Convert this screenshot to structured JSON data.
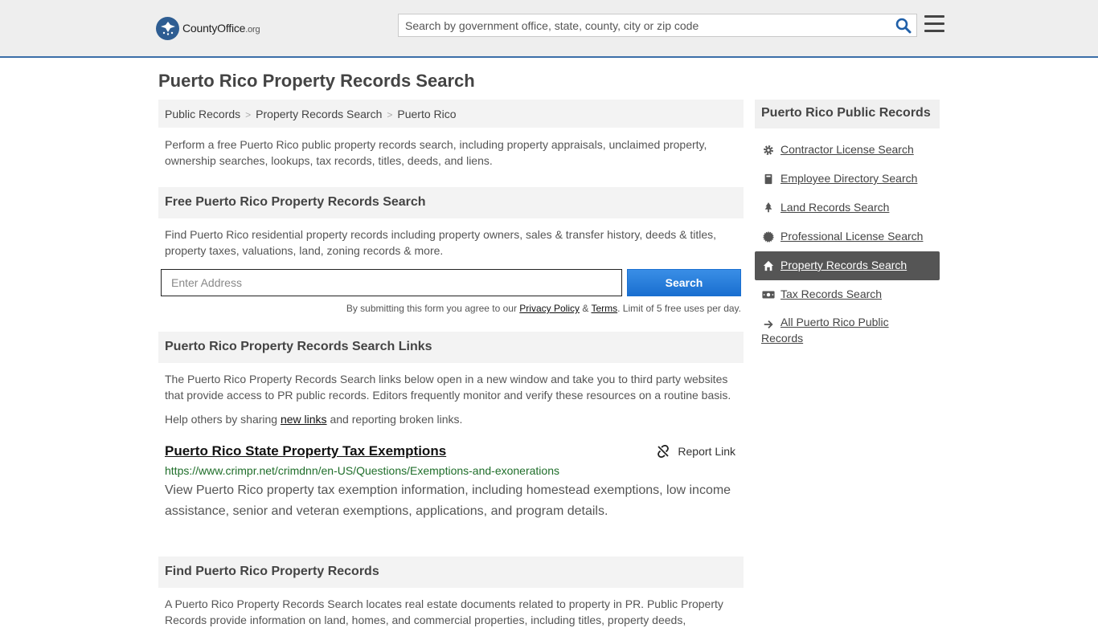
{
  "header": {
    "logo_main": "CountyOffice",
    "logo_suffix": ".org",
    "search_placeholder": "Search by government office, state, county, city or zip code"
  },
  "page_title": "Puerto Rico Property Records Search",
  "breadcrumb": [
    "Public Records",
    "Property Records Search",
    "Puerto Rico"
  ],
  "intro": "Perform a free Puerto Rico public property records search, including property appraisals, unclaimed property, ownership searches, lookups, tax records, titles, deeds, and liens.",
  "free_search": {
    "heading": "Free Puerto Rico Property Records Search",
    "description": "Find Puerto Rico residential property records including property owners, sales & transfer history, deeds & titles, property taxes, valuations, land, zoning records & more.",
    "address_placeholder": "Enter Address",
    "button_label": "Search",
    "terms_prefix": "By submitting this form you agree to our",
    "privacy_label": "Privacy Policy",
    "amp": "&",
    "terms_label": "Terms",
    "terms_suffix": ". Limit of 5 free uses per day."
  },
  "links_section": {
    "heading": "Puerto Rico Property Records Search Links",
    "description": "The Puerto Rico Property Records Search links below open in a new window and take you to third party websites that provide access to PR public records. Editors frequently monitor and verify these resources on a routine basis.",
    "share_prefix": "Help others by sharing",
    "share_link": "new links",
    "share_suffix": "and reporting broken links.",
    "entries": [
      {
        "title": "Puerto Rico State Property Tax Exemptions",
        "report_label": "Report Link",
        "url": "https://www.crimpr.net/crimdnn/en-US/Questions/Exemptions-and-exonerations",
        "description": "View Puerto Rico property tax exemption information, including homestead exemptions, low income assistance, senior and veteran exemptions, applications, and program details."
      }
    ]
  },
  "find_section": {
    "heading": "Find Puerto Rico Property Records",
    "description": "A Puerto Rico Property Records Search locates real estate documents related to property in PR. Public Property Records provide information on land, homes, and commercial properties, including titles, property deeds,"
  },
  "sidebar": {
    "heading": "Puerto Rico Public Records",
    "items": [
      {
        "label": "Contractor License Search",
        "icon": "gear-icon",
        "active": false
      },
      {
        "label": "Employee Directory Search",
        "icon": "book-icon",
        "active": false
      },
      {
        "label": "Land Records Search",
        "icon": "tree-icon",
        "active": false
      },
      {
        "label": "Professional License Search",
        "icon": "certificate-icon",
        "active": false
      },
      {
        "label": "Property Records Search",
        "icon": "home-icon",
        "active": true
      },
      {
        "label": "Tax Records Search",
        "icon": "money-icon",
        "active": false
      }
    ],
    "all_line1": "All Puerto Rico Public",
    "all_line2": "Records"
  },
  "colors": {
    "brand_blue": "#2e5d92",
    "header_border": "#3b6ea8",
    "search_button": "#1a6fd0",
    "url_green": "#1f6e2a",
    "active_item": "#555555"
  }
}
